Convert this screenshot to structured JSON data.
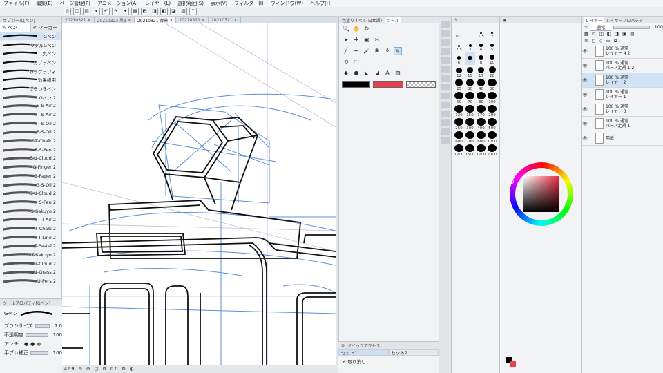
{
  "menu": [
    "ファイル(F)",
    "編集(E)",
    "ページ管理(P)",
    "アニメーション(A)",
    "レイヤー(L)",
    "選択範囲(S)",
    "表示(V)",
    "フィルター(I)",
    "ウィンドウ(W)",
    "ヘルプ(H)"
  ],
  "toolbar_icons": [
    "◎",
    "▢",
    "▤",
    "▾",
    "↶",
    "↷",
    "✦",
    "▦",
    "◩",
    "◨",
    "◧",
    "◪",
    "▧",
    "?"
  ],
  "left_panel": {
    "header": "サブツール[ペン]",
    "tab_pen": "ペン",
    "tab_marker": "マーカー",
    "brushes": [
      "Gペン",
      "リアルGペン",
      "丸ペン",
      "カブラペン",
      "カリグラフィ",
      "効果線用",
      "ざらつきペン",
      "Gペン 2",
      "E-S-Air 2",
      "S-Air 2",
      "S-Oil 2",
      "E-S-Oil 2",
      "E-T-Chalk 2",
      "E-S-Pen 2",
      "E-U-Cloud 2",
      "G-Finger 2",
      "G-Paper 2",
      "G-S-Oil 2",
      "G-U-Cloud 2",
      "S-Pen 2",
      "S-Sakuyo 2",
      "T-Air 2",
      "T-Chalk 2",
      "T-Line 2",
      "T-Pastel 2",
      "T-Sakuyo 2",
      "U-Cloud 2",
      "U-Grass 2",
      "U-Pers 2"
    ],
    "selected_brush": "Gペン"
  },
  "tool_property": {
    "header": "ツールプロパティ[Gペン]",
    "tool_name": "Gペン",
    "brush_size_label": "ブラシサイズ",
    "brush_size_value": "7.0",
    "opacity_label": "不透明度",
    "opacity_value": "100",
    "antialias_label": "アンチ",
    "stabilization_label": "手ブレ補正",
    "stabilization_value": "100"
  },
  "doc_tabs": [
    "20210321",
    "20210323 黒3",
    "20210321 背景",
    "20210321",
    "20210321"
  ],
  "active_doc_tab": 2,
  "status": {
    "zoom": "42.9",
    "angle": "0.0"
  },
  "tool_panel": {
    "header_left": "色塗りすべて(日本語)",
    "header_right": "ツール",
    "tools_row1": [
      "🔍",
      "✋",
      "↻"
    ],
    "tools_row2": [
      "➤",
      "✚",
      "▣",
      "✂"
    ],
    "tools_row3": [
      "╱",
      "✒",
      "🖌",
      "✱",
      "⚱",
      "✎"
    ],
    "tools_row4": [
      "⟲",
      "⬚"
    ],
    "tools_row5": [
      "◆",
      "●",
      "◣",
      "◢",
      "A",
      "▨"
    ],
    "main_color": "#000000",
    "sub_color": "#e8404f"
  },
  "quick_access": {
    "title": "クイックアクセス",
    "set1": "セット1",
    "set2": "セット2",
    "item": "取り消し"
  },
  "brush_sizes": [
    "0.7",
    "1",
    "1.5",
    "2",
    "2.5",
    "3",
    "4",
    "5",
    "6",
    "7",
    "8",
    "10",
    "12",
    "15",
    "17",
    "20",
    "25",
    "30",
    "40",
    "50",
    "60",
    "70",
    "80",
    "100",
    "120",
    "150",
    "170",
    "200",
    "250",
    "300",
    "400",
    "500",
    "600",
    "700",
    "800",
    "1000",
    "1200",
    "1500",
    "1700",
    "2000"
  ],
  "selected_brush_size": "7",
  "color_panel": {
    "hue_color": "#e8283c"
  },
  "layer_panel": {
    "tab1": "レイヤー",
    "tab2": "レイヤープロパティ",
    "blend_mode": "通常",
    "opacity": "100",
    "layers": [
      {
        "line1": "100 % 通常",
        "line2": "レイヤー 4 2",
        "selected": false
      },
      {
        "line1": "100 % 通常",
        "line2": "パース定規 1 2",
        "selected": false
      },
      {
        "line1": "100 % 通常",
        "line2": "レイヤー 2",
        "selected": true
      },
      {
        "line1": "100 % 通常",
        "line2": "レイヤー 1",
        "selected": false
      },
      {
        "line1": "100 % 通常",
        "line2": "レイヤー 3",
        "selected": false
      },
      {
        "line1": "100 % 通常",
        "line2": "パース定規 1",
        "selected": false
      },
      {
        "line1": "",
        "line2": "用紙",
        "selected": false
      }
    ]
  }
}
